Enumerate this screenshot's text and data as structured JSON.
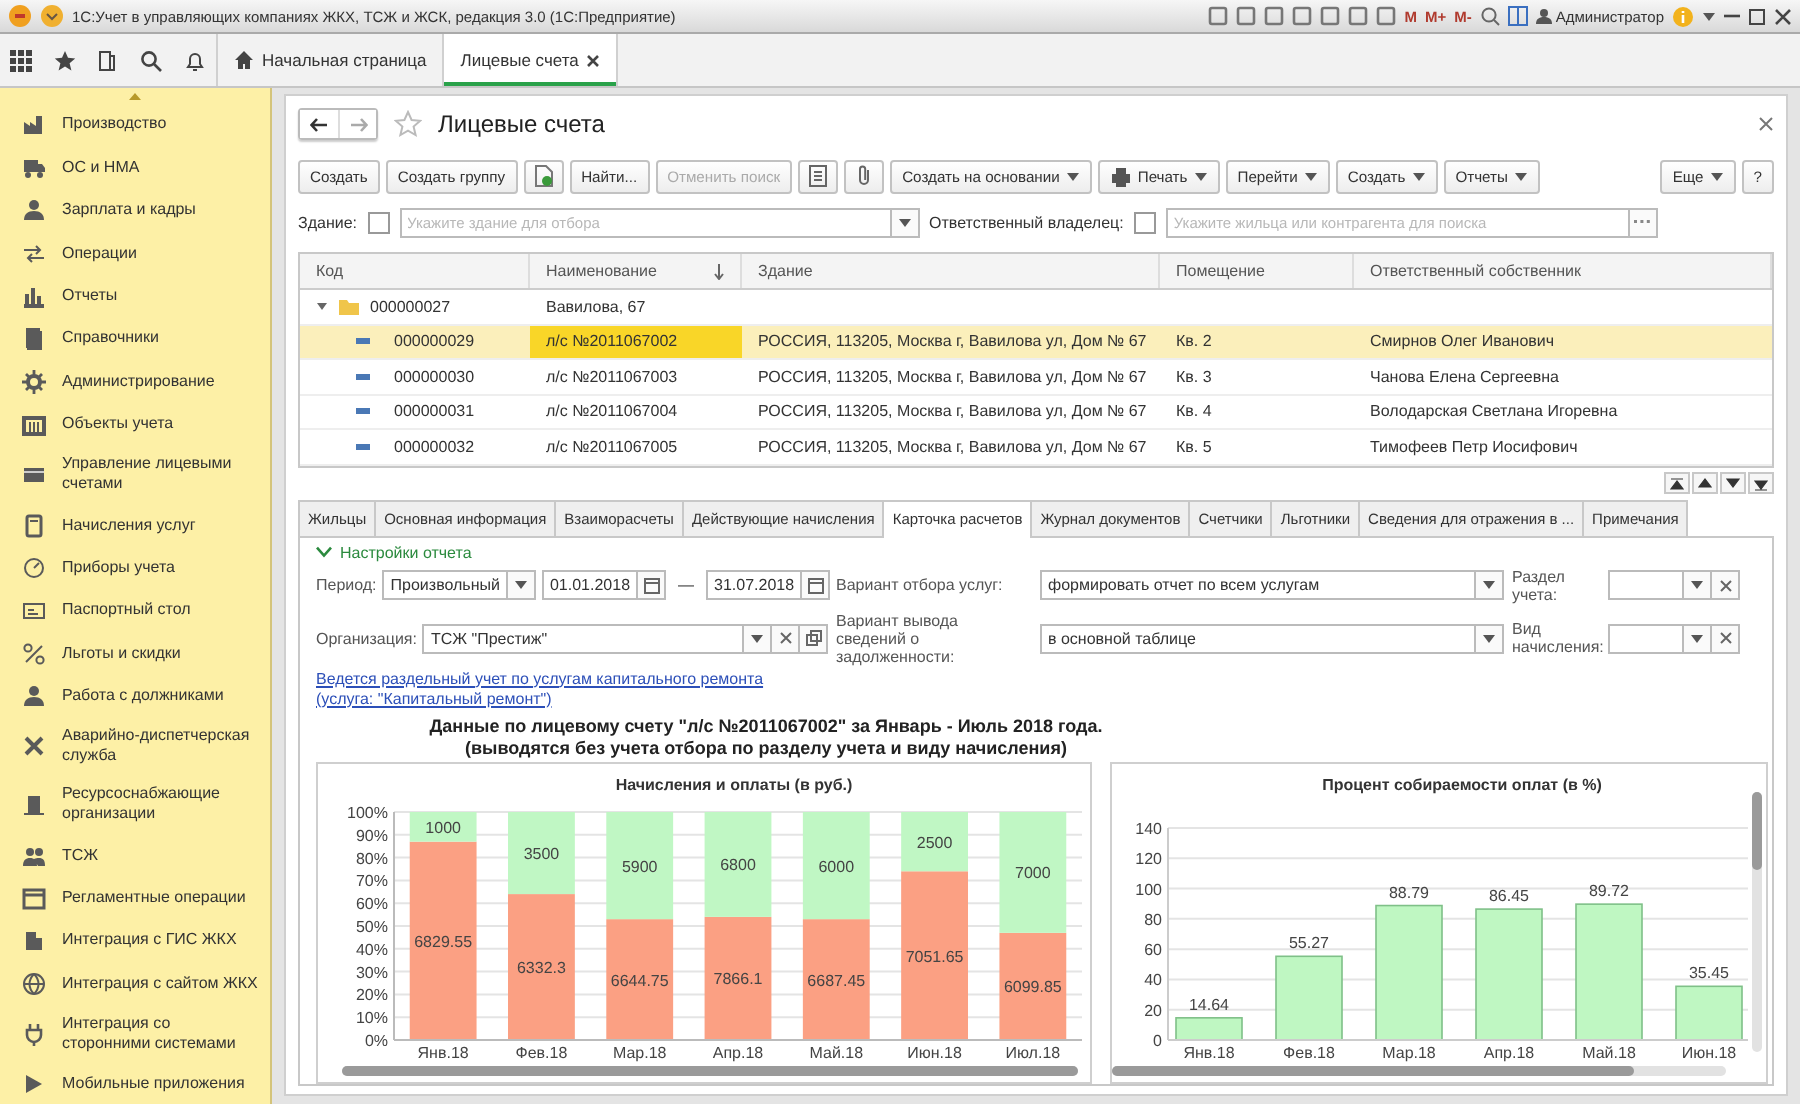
{
  "window": {
    "title": "1С:Учет в управляющих компаниях ЖКХ, ТСЖ и ЖСК, редакция 3.0  (1С:Предприятие)",
    "memory_buttons": [
      "M",
      "M+",
      "M-"
    ],
    "user": "Администратор"
  },
  "app_tabs": [
    {
      "label": "Начальная страница",
      "selected": false,
      "closable": false
    },
    {
      "label": "Лицевые счета",
      "selected": true,
      "closable": true
    }
  ],
  "sidebar": {
    "items": [
      {
        "label": "Производство"
      },
      {
        "label": "ОС и НМА"
      },
      {
        "label": "Зарплата и кадры"
      },
      {
        "label": "Операции"
      },
      {
        "label": "Отчеты"
      },
      {
        "label": "Справочники"
      },
      {
        "label": "Администрирование"
      },
      {
        "label": "Объекты учета"
      },
      {
        "label": "Управление лицевыми счетами"
      },
      {
        "label": "Начисления услуг"
      },
      {
        "label": "Приборы учета"
      },
      {
        "label": "Паспортный стол"
      },
      {
        "label": "Льготы и скидки"
      },
      {
        "label": "Работа с должниками"
      },
      {
        "label": "Аварийно-диспетчерская служба"
      },
      {
        "label": "Ресурсоснабжающие организации"
      },
      {
        "label": "ТСЖ"
      },
      {
        "label": "Регламентные операции"
      },
      {
        "label": "Интеграция с ГИС ЖКХ"
      },
      {
        "label": "Интеграция с сайтом ЖКХ"
      },
      {
        "label": "Интеграция со сторонними системами"
      },
      {
        "label": "Мобильные приложения"
      }
    ]
  },
  "form": {
    "title": "Лицевые счета",
    "toolbar": [
      {
        "label": "Создать",
        "kind": "text",
        "disabled": false
      },
      {
        "label": "Создать группу",
        "kind": "text",
        "disabled": false
      },
      {
        "kind": "icon",
        "disabled": false
      },
      {
        "label": "Найти...",
        "kind": "text",
        "disabled": false
      },
      {
        "label": "Отменить поиск",
        "kind": "text",
        "disabled": true
      },
      {
        "kind": "icon",
        "disabled": false
      },
      {
        "kind": "icon",
        "disabled": false
      },
      {
        "label": "Создать на основании",
        "kind": "menu",
        "disabled": false
      },
      {
        "label": "Печать",
        "kind": "icon_menu",
        "disabled": false
      },
      {
        "label": "Перейти",
        "kind": "menu",
        "disabled": false
      },
      {
        "label": "Создать",
        "kind": "menu",
        "disabled": false
      },
      {
        "label": "Отчеты",
        "kind": "menu",
        "disabled": false
      }
    ],
    "toolbar_right": [
      {
        "label": "Еще",
        "kind": "menu",
        "disabled": false
      },
      {
        "label": "?",
        "kind": "text",
        "disabled": false
      }
    ],
    "filters": [
      {
        "label": "Здание:",
        "checked": false,
        "placeholder": "Укажите здание для отбора",
        "kind": "dropdown"
      },
      {
        "label": "Ответственный владелец:",
        "checked": false,
        "placeholder": "Укажите жильца или контрагента для поиска",
        "kind": "select"
      }
    ],
    "table": {
      "columns": [
        {
          "label": "Код",
          "sorted": false
        },
        {
          "label": "Наименование",
          "sorted": true
        },
        {
          "label": "Здание",
          "sorted": false
        },
        {
          "label": "Помещение",
          "sorted": false
        },
        {
          "label": "Ответственный собственник",
          "sorted": false
        }
      ],
      "rows": [
        {
          "kind": "group",
          "code": "000000027",
          "name": "Вавилова, 67",
          "expanded": true,
          "selected": false,
          "children": [
            {
              "kind": "item",
              "code": "000000029",
              "name": "л/с №2011067002",
              "building": "РОССИЯ, 113205, Москва г, Вавилова ул, Дом № 67",
              "room": "Кв. 2",
              "owner": "Смирнов Олег Иванович",
              "selected": true
            },
            {
              "kind": "item",
              "code": "000000030",
              "name": "л/с №2011067003",
              "building": "РОССИЯ, 113205, Москва г, Вавилова ул, Дом № 67",
              "room": "Кв. 3",
              "owner": "Чанова Елена Сергеевна",
              "selected": false
            },
            {
              "kind": "item",
              "code": "000000031",
              "name": "л/с №2011067004",
              "building": "РОССИЯ, 113205, Москва г, Вавилова ул, Дом № 67",
              "room": "Кв. 4",
              "owner": "Володарская Светлана Игоревна",
              "selected": false
            },
            {
              "kind": "item",
              "code": "000000032",
              "name": "л/с №2011067005",
              "building": "РОССИЯ, 113205, Москва г, Вавилова ул, Дом № 67",
              "room": "Кв. 5",
              "owner": "Тимофеев Петр Иосифович",
              "selected": false
            }
          ]
        }
      ]
    },
    "detail_tabs": [
      {
        "label": "Жильцы",
        "selected": false
      },
      {
        "label": "Основная информация",
        "selected": false
      },
      {
        "label": "Взаиморасчеты",
        "selected": false
      },
      {
        "label": "Действующие начисления",
        "selected": false
      },
      {
        "label": "Карточка расчетов",
        "selected": true
      },
      {
        "label": "Журнал документов",
        "selected": false
      },
      {
        "label": "Счетчики",
        "selected": false
      },
      {
        "label": "Льготники",
        "selected": false
      },
      {
        "label": "Сведения для отражения в ...",
        "selected": false
      },
      {
        "label": "Примечания",
        "selected": false
      }
    ],
    "report": {
      "settings_title": "Настройки отчета",
      "expanded": true,
      "period": {
        "label": "Период:",
        "value": "Произвольный",
        "from": "01.01.2018",
        "separator": "—",
        "to": "31.07.2018"
      },
      "organization": {
        "label": "Организация:",
        "value": "ТСЖ \"Престиж\""
      },
      "service_filter": {
        "label": "Вариант отбора услуг:",
        "value": "формировать отчет по всем услугам"
      },
      "debt_output": {
        "label": "Вариант вывода сведений о задолженности:",
        "value": "в основной таблице"
      },
      "section": {
        "label": "Раздел учета:"
      },
      "charge_type": {
        "label": "Вид начисления:"
      },
      "link": "Ведется раздельный учет по услугам капитального ремонта (услуга: \"Капитальный ремонт\")",
      "heading": [
        "Данные по лицевому счету \"л/с №2011067002\" за Январь - Июль 2018 года.",
        "(выводятся без учета отбора по разделу учета и виду начисления)"
      ],
      "charts": [
        {
          "chart_data": {
            "type": "bar",
            "title": "Начисления и оплаты (в руб.)",
            "categories": [
              "Янв.18",
              "Фев.18",
              "Мар.18",
              "Апр.18",
              "Май.18",
              "Июн.18",
              "Июл.18"
            ],
            "stacked": true,
            "grid": true,
            "ylim": [
              0,
              100
            ],
            "yticks": [
              {
                "value": 0,
                "label": "0%"
              },
              {
                "value": 10,
                "label": "10%"
              },
              {
                "value": 20,
                "label": "20%"
              },
              {
                "value": 30,
                "label": "30%"
              },
              {
                "value": 40,
                "label": "40%"
              },
              {
                "value": 50,
                "label": "50%"
              },
              {
                "value": 60,
                "label": "60%"
              },
              {
                "value": 70,
                "label": "70%"
              },
              {
                "value": 80,
                "label": "80%"
              },
              {
                "value": 90,
                "label": "90%"
              },
              {
                "value": 100,
                "label": "100%"
              }
            ],
            "series": [
              {
                "color": "#fba083",
                "values": [
                  87,
                  64,
                  53,
                  54,
                  53,
                  74,
                  47
                ]
              },
              {
                "color": "#c0f7c4",
                "values": [
                  13,
                  36,
                  47,
                  46,
                  47,
                  26,
                  53
                ]
              }
            ],
            "value_labels": [
              [
                "6829.55",
                "6332.3",
                "6644.75",
                "7866.1",
                "6687.45",
                "7051.65",
                "6099.85"
              ],
              [
                "1000",
                "3500",
                "5900",
                "6800",
                "6000",
                "2500",
                "7000"
              ]
            ]
          }
        },
        {
          "chart_data": {
            "type": "bar",
            "title": "Процент собираемости оплат (в %)",
            "categories": [
              "Янв.18",
              "Фев.18",
              "Мар.18",
              "Апр.18",
              "Май.18",
              "Июн.18"
            ],
            "data_labels": true,
            "grid": true,
            "ylim": [
              0,
              140
            ],
            "yticks": [
              0,
              20,
              40,
              60,
              80,
              100,
              120,
              140
            ],
            "series": [
              {
                "color": "#bff7c2",
                "values": [
                  14.64,
                  55.27,
                  88.79,
                  86.45,
                  89.72,
                  35.45
                ]
              }
            ]
          }
        }
      ]
    }
  }
}
